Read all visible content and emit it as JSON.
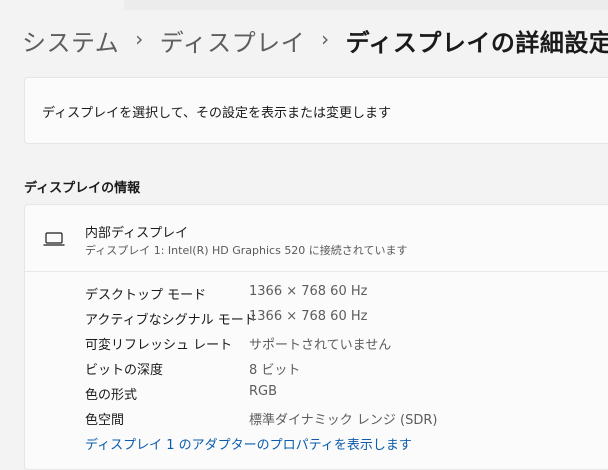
{
  "breadcrumb": {
    "items": [
      "システム",
      "ディスプレイ"
    ],
    "separator": "›",
    "current": "ディスプレイの詳細設定"
  },
  "select_display": {
    "description": "ディスプレイを選択して、その設定を表示または変更します"
  },
  "display_info": {
    "section_title": "ディスプレイの情報",
    "icon": "laptop-icon",
    "name": "内部ディスプレイ",
    "subtitle": "ディスプレイ 1: Intel(R) HD Graphics 520 に接続されています",
    "properties": [
      {
        "label": "デスクトップ モード",
        "value": "1366 × 768 60 Hz"
      },
      {
        "label": "アクティブなシグナル モード",
        "value": "1366 × 768 60 Hz"
      },
      {
        "label": "可変リフレッシュ レート",
        "value": "サポートされていません"
      },
      {
        "label": "ビットの深度",
        "value": "8 ビット"
      },
      {
        "label": "色の形式",
        "value": "RGB"
      },
      {
        "label": "色空間",
        "value": "標準ダイナミック レンジ (SDR)"
      }
    ],
    "adapter_link": "ディスプレイ 1 のアダプターのプロパティを表示します"
  },
  "colors": {
    "background": "#f3f3f3",
    "card": "#fbfbfb",
    "link": "#0b5cad"
  }
}
